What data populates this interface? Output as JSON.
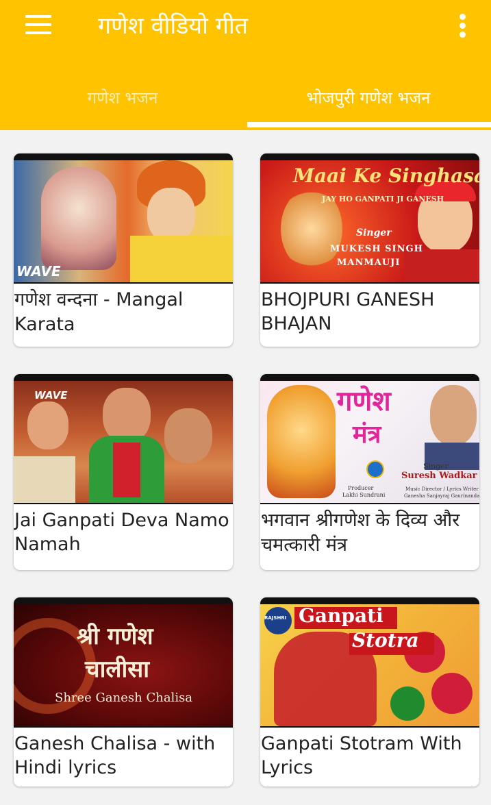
{
  "app": {
    "title": "गणेश वीडियो गीत"
  },
  "tabs": [
    {
      "label": "गणेश भजन",
      "selected": false
    },
    {
      "label": "भोजपुरी गणेश भजन",
      "selected": true
    }
  ],
  "colors": {
    "appbar": "#ffc300",
    "background": "#f2f2f2"
  },
  "videos": [
    {
      "title": "गणेश वन्दना - Mangal Karata",
      "thumb_text": [
        "WAVE"
      ]
    },
    {
      "title": "BHOJPURI GANESH BHAJAN",
      "thumb_text": [
        "Maai Ke Singhasan",
        "JAY HO GANPATI JI GANESH",
        "Singer",
        "MUKESH SINGH",
        "MANMAUJI"
      ]
    },
    {
      "title": "Jai Ganpati Deva Namo Namah",
      "thumb_text": [
        "WAVE"
      ]
    },
    {
      "title": "भगवान श्रीगणेश के दिव्य और चमत्कारी मंत्र",
      "thumb_text": [
        "गणेश",
        "मंत्र",
        "Singer",
        "Suresh Wadkar",
        "Producer",
        "Lakhi Sundrani",
        "Music Director / Lyrics Writer",
        "Ganesha Sanjayraj Gaurinandan"
      ]
    },
    {
      "title": "Ganesh Chalisa - with Hindi lyrics",
      "thumb_text": [
        "श्री गणेश",
        "चालीसा",
        "Shree Ganesh Chalisa"
      ]
    },
    {
      "title": "Ganpati Stotram With Lyrics",
      "thumb_text": [
        "Ganpati",
        "Stotra",
        "RAJSHRI"
      ]
    }
  ]
}
